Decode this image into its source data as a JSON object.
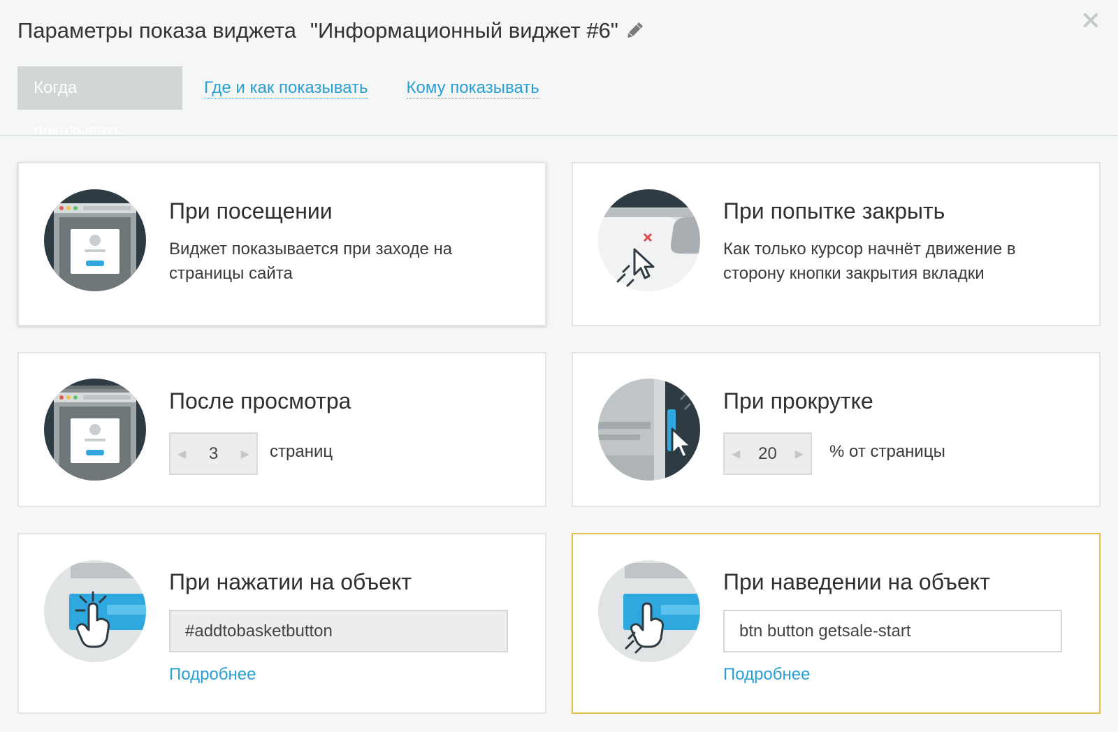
{
  "header": {
    "title": "Параметры показа виджета",
    "widget_name": "\"Информационный виджет #6\""
  },
  "tabs": [
    {
      "label": "Когда показывать",
      "active": true
    },
    {
      "label": "Где и как показывать",
      "active": false
    },
    {
      "label": "Кому показывать",
      "active": false
    }
  ],
  "cards": {
    "visit": {
      "title": "При посещении",
      "description": "Виджет показывается при заходе на страницы сайта"
    },
    "close_attempt": {
      "title": "При попытке закрыть",
      "description": "Как только курсор начнёт движение в сторону кнопки закрытия вкладки"
    },
    "after_view": {
      "title": "После просмотра",
      "pages_value": "3",
      "unit": "страниц"
    },
    "scroll": {
      "title": "При прокрутке",
      "percent_value": "20",
      "unit": "% от страницы"
    },
    "click_object": {
      "title": "При нажатии на объект",
      "selector": "#addtobasketbutton",
      "more_link": "Подробнее"
    },
    "hover_object": {
      "title": "При наведении на объект",
      "selector": "btn button getsale-start",
      "more_link": "Подробнее",
      "selected": true
    }
  },
  "colors": {
    "link": "#2a9fd6",
    "active_tab_bg": "#d3d6d6",
    "selected_border": "#e2c24c",
    "icon_dark": "#2e3b42",
    "icon_blue": "#2ea8df"
  },
  "icons": [
    "pencil-icon",
    "close-icon",
    "browser-window-icon",
    "cursor-close-tab-icon",
    "browser-pages-icon",
    "scrollbar-cursor-icon",
    "click-hand-icon",
    "hover-hand-icon"
  ]
}
